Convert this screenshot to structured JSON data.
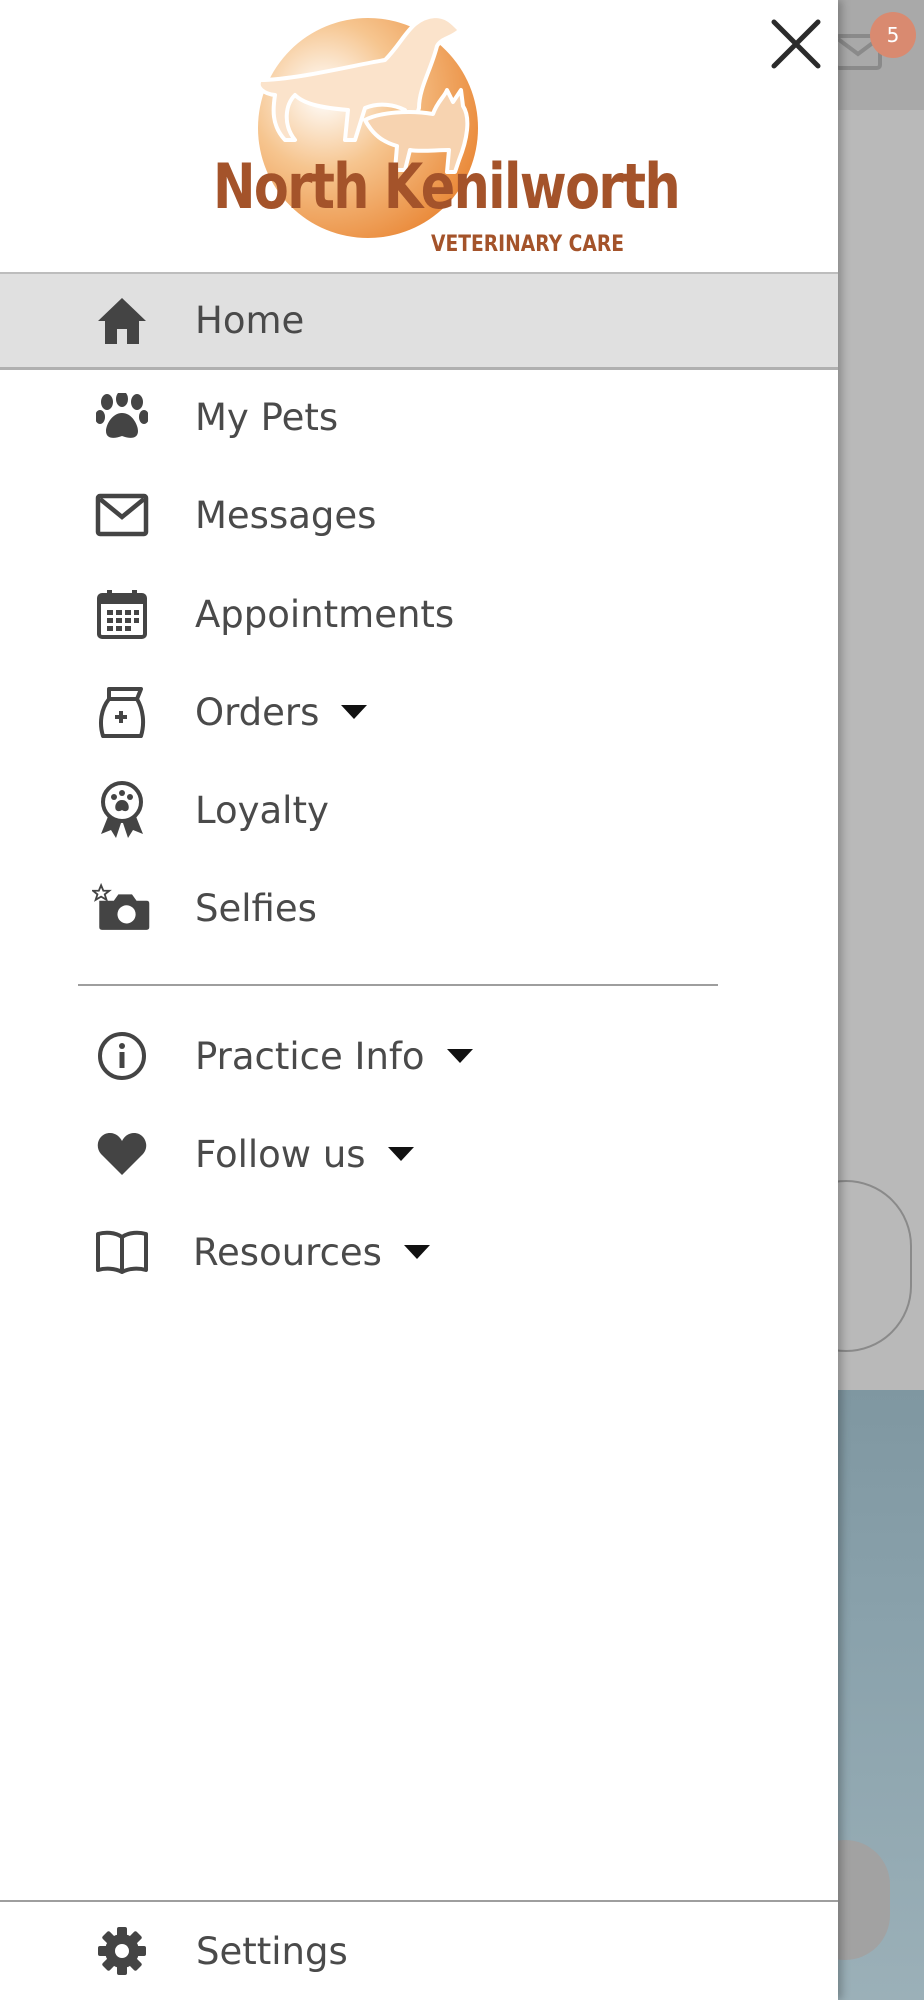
{
  "background": {
    "message_badge_count": "5"
  },
  "logo": {
    "title": "North Kenilworth",
    "subtitle": "VETERINARY CARE",
    "brand_color": "#a4532a",
    "accent_color": "#ef9a45"
  },
  "menu": {
    "items": [
      {
        "label": "Home",
        "icon": "home-icon",
        "active": true
      },
      {
        "label": "My Pets",
        "icon": "paw-icon"
      },
      {
        "label": "Messages",
        "icon": "envelope-icon"
      },
      {
        "label": "Appointments",
        "icon": "calendar-icon"
      },
      {
        "label": "Orders",
        "icon": "food-bag-icon",
        "dropdown": true
      },
      {
        "label": "Loyalty",
        "icon": "award-ribbon-icon"
      },
      {
        "label": "Selfies",
        "icon": "camera-icon"
      },
      {
        "label": "Practice Info",
        "icon": "info-icon",
        "dropdown": true
      },
      {
        "label": "Follow us",
        "icon": "heart-icon",
        "dropdown": true
      },
      {
        "label": "Resources",
        "icon": "book-icon",
        "dropdown": true
      }
    ]
  },
  "footer": {
    "settings_label": "Settings",
    "settings_icon": "gear-icon"
  },
  "colors": {
    "active_item_bg": "#e0e0e0",
    "icon_color": "#444444",
    "text_color": "#4a4a4a"
  }
}
